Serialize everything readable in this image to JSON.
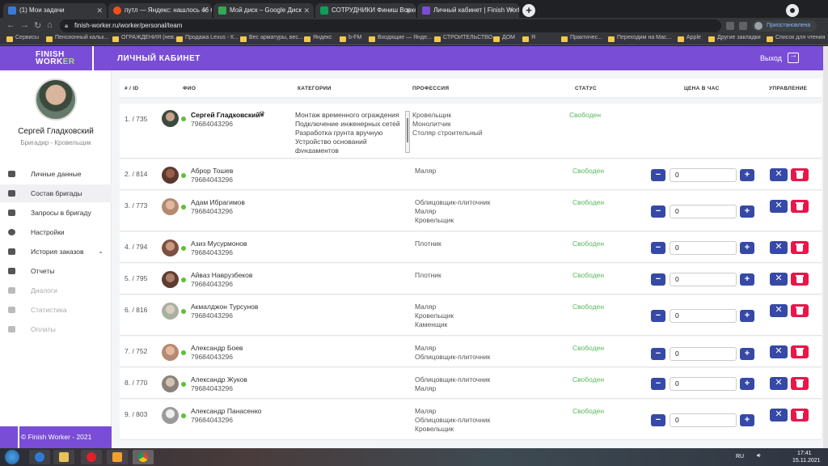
{
  "browser": {
    "tabs": [
      {
        "label": "(1) Мои задачи",
        "badge": "24",
        "color": "#3a7bd5"
      },
      {
        "label": "путл — Яндекс: нашлось 46 млн",
        "color": "#f24f1c"
      },
      {
        "label": "Мой диск – Google Диск",
        "color": "#34a853"
      },
      {
        "label": "СОТРУДНИКИ Финиш Воркер.xls",
        "color": "#0f9d58"
      },
      {
        "label": "Личный кабинет | Finish Worker",
        "color": "#7a4dd6"
      }
    ],
    "url": "finish-worker.ru/worker/personal/team",
    "profile_label": "Приостановлена",
    "bookmarks": [
      "Сервисы",
      "Пенсионный кальк...",
      "ОГРАЖДЕНИЯ (нев...",
      "Продажа Lexus - К...",
      "Вес арматуры, вес...",
      "Яндекс",
      "b-FM",
      "Входящие — Янде...",
      "СТРОИТЕЛЬСТВО",
      "ДОМ",
      "Я",
      "Практичес...",
      "Переходим на Мас...",
      "Apple",
      "Другие закладки",
      "Список для чтения"
    ]
  },
  "header": {
    "logo_line1": "FINISH",
    "logo_line2a": "WORK",
    "logo_line2b": "ER",
    "title": "ЛИЧНЫЙ КАБИНЕТ",
    "logout_label": "Выход"
  },
  "sidebar": {
    "user_name": "Сергей Гладковский",
    "user_role": "Бригадир - Кровельщик",
    "items": [
      {
        "label": "Личные данные",
        "disabled": false,
        "active": false
      },
      {
        "label": "Состав бригады",
        "disabled": false,
        "active": true
      },
      {
        "label": "Запросы в бригаду",
        "disabled": false,
        "active": false
      },
      {
        "label": "Настройки",
        "disabled": false,
        "active": false
      },
      {
        "label": "История заказов",
        "disabled": false,
        "active": false,
        "chevron": "⌄"
      },
      {
        "label": "Отчеты",
        "disabled": false,
        "active": false
      },
      {
        "label": "Диалоги",
        "disabled": true,
        "active": false
      },
      {
        "label": "Статистика",
        "disabled": true,
        "active": false
      },
      {
        "label": "Оплаты",
        "disabled": true,
        "active": false
      }
    ],
    "footer": "© Finish Worker - 2021"
  },
  "table": {
    "headers": {
      "id": "# / ID",
      "name": "ФИО",
      "categories": "КАТЕГОРИИ",
      "profession": "ПРОФЕССИЯ",
      "status": "СТАТУС",
      "price": "ЦЕНА В ЧАС",
      "manage": "УПРАВЛЕНИЕ"
    },
    "leader": {
      "id": "1. / 735",
      "name": "Сергей Гладковский",
      "phone": "79684043296",
      "categories": [
        "Монтаж временного ограждения",
        "Подключение инженерных сетей",
        "Разработка грунта вручную",
        "Устройство оснований",
        "фундаментов"
      ],
      "professions": [
        "Кровельщик",
        "Монолитчик",
        "Столяр строительный"
      ],
      "status": "Свободен"
    },
    "rows": [
      {
        "id": "2. / 814",
        "name": "Аброр Тошев",
        "phone": "79684043296",
        "professions": [
          "Маляр"
        ],
        "status": "Свободен",
        "price": "0"
      },
      {
        "id": "3. / 773",
        "name": "Адам Ибрагимов",
        "phone": "79684043296",
        "professions": [
          "Облицовщик-плиточник",
          "Маляр",
          "Кровельщик"
        ],
        "status": "Свободен",
        "price": "0"
      },
      {
        "id": "4. / 794",
        "name": "Азиз Мусурмонов",
        "phone": "79684043296",
        "professions": [
          "Плотник"
        ],
        "status": "Свободен",
        "price": "0"
      },
      {
        "id": "5. / 795",
        "name": "Айваз Наврузбеков",
        "phone": "79684043296",
        "professions": [
          "Плотник"
        ],
        "status": "Свободен",
        "price": "0"
      },
      {
        "id": "6. / 816",
        "name": "Акмалджон Турсунов",
        "phone": "79684043296",
        "professions": [
          "Маляр",
          "Кровельщик",
          "Каменщик"
        ],
        "status": "Свободен",
        "price": "0"
      },
      {
        "id": "7. / 752",
        "name": "Александр Боев",
        "phone": "79684043296",
        "professions": [
          "Маляр",
          "Облицовщик-плиточник"
        ],
        "status": "Свободен",
        "price": "0"
      },
      {
        "id": "8. / 770",
        "name": "Александр Жуков",
        "phone": "79684043296",
        "professions": [
          "Облицовщик-плиточник",
          "Маляр"
        ],
        "status": "Свободен",
        "price": "0"
      },
      {
        "id": "9. / 803",
        "name": "Александр Панасенко",
        "phone": "79684043296",
        "professions": [
          "Маляр",
          "Облицовщик-плиточник",
          "Кровельщик"
        ],
        "status": "Свободен",
        "price": "0"
      }
    ],
    "minus": "−",
    "plus": "+",
    "remove_x": "✕"
  },
  "taskbar": {
    "lang": "RU",
    "time": "17:41",
    "date": "15.11.2021"
  },
  "colors": {
    "brand": "#7a4dd6",
    "accent_green": "#a7e26b",
    "button_blue": "#3649a7",
    "delete_red": "#e8164b",
    "status_green": "#5bb75b"
  }
}
